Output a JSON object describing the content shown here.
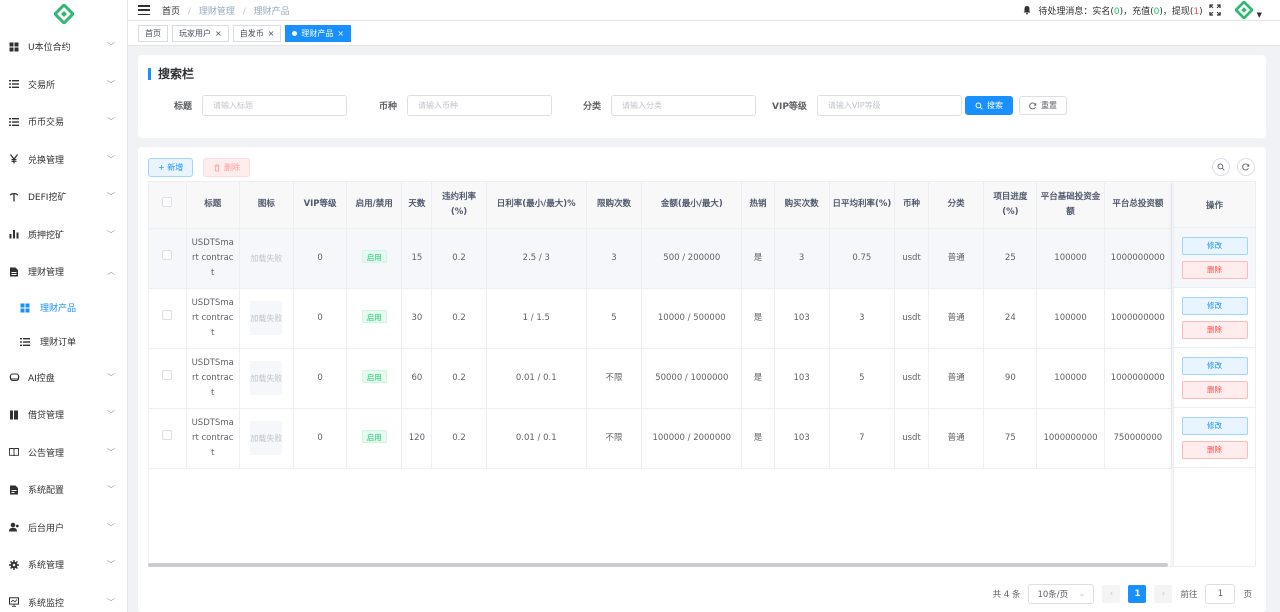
{
  "sidebar": {
    "items": [
      {
        "label": "U本位合约",
        "icon": "grid-icon"
      },
      {
        "label": "交易所",
        "icon": "list-icon"
      },
      {
        "label": "币币交易",
        "icon": "list-icon"
      },
      {
        "label": "兑换管理",
        "icon": "yen-icon"
      },
      {
        "label": "DEFI挖矿",
        "icon": "pickaxe-icon"
      },
      {
        "label": "质押挖矿",
        "icon": "chart-icon"
      },
      {
        "label": "理财管理",
        "icon": "finance-icon"
      }
    ],
    "sub_items": [
      {
        "label": "理财产品",
        "icon": "grid-icon"
      },
      {
        "label": "理财订单",
        "icon": "list-icon"
      }
    ],
    "items_after": [
      {
        "label": "AI控盘",
        "icon": "robot-icon"
      },
      {
        "label": "借贷管理",
        "icon": "book-icon"
      },
      {
        "label": "公告管理",
        "icon": "notice-icon"
      },
      {
        "label": "系统配置",
        "icon": "doc-icon"
      },
      {
        "label": "后台用户",
        "icon": "user-icon"
      },
      {
        "label": "系统管理",
        "icon": "gear-icon"
      },
      {
        "label": "系统监控",
        "icon": "monitor-icon"
      }
    ]
  },
  "header": {
    "breadcrumb": [
      "首页",
      "理财管理",
      "理财产品"
    ],
    "pending_label": "待处理消息：实名(",
    "pending_realname": "0",
    "pending_recharge_label": ")，充值(",
    "pending_recharge": "0",
    "pending_withdraw_label": ")，提现(",
    "pending_withdraw": "1",
    "pending_end": ")"
  },
  "tabs": [
    {
      "label": "首页",
      "closable": false
    },
    {
      "label": "玩家用户",
      "closable": true
    },
    {
      "label": "自发币",
      "closable": true
    },
    {
      "label": "理财产品",
      "closable": true,
      "active": true
    }
  ],
  "search": {
    "title": "搜索栏",
    "fields": [
      {
        "label": "标题",
        "placeholder": "请输入标题"
      },
      {
        "label": "币种",
        "placeholder": "请输入币种"
      },
      {
        "label": "分类",
        "placeholder": "请输入分类"
      },
      {
        "label": "VIP等级",
        "placeholder": "请输入VIP等级"
      }
    ],
    "search_btn": "搜索",
    "reset_btn": "重置"
  },
  "toolbar": {
    "add": "+ 新增",
    "delete": "删除"
  },
  "table": {
    "columns": [
      "标题",
      "图标",
      "VIP等级",
      "启用/禁用",
      "天数",
      "违约利率(%)",
      "日利率(最小/最大)%",
      "限购次数",
      "金额(最小/最大)",
      "热销",
      "购买次数",
      "日平均利率(%)",
      "币种",
      "分类",
      "项目进度(%)",
      "平台基础投资金额",
      "平台总投资额"
    ],
    "ops_header": "操作",
    "rows": [
      {
        "title": "USDTSmart contract",
        "icon": "加载失败",
        "vip": "0",
        "status": "启用",
        "days": "15",
        "penalty": "0.2",
        "daily_rate": "2.5 / 3",
        "limit": "3",
        "amount": "500 / 200000",
        "hot": "是",
        "buys": "3",
        "avg_rate": "0.75",
        "coin": "usdt",
        "category": "普通",
        "progress": "25",
        "base_invest": "100000",
        "total_invest": "1000000000"
      },
      {
        "title": "USDTSmart contract",
        "icon": "加载失败",
        "vip": "0",
        "status": "启用",
        "days": "30",
        "penalty": "0.2",
        "daily_rate": "1 / 1.5",
        "limit": "5",
        "amount": "10000 / 500000",
        "hot": "是",
        "buys": "103",
        "avg_rate": "3",
        "coin": "usdt",
        "category": "普通",
        "progress": "24",
        "base_invest": "100000",
        "total_invest": "1000000000"
      },
      {
        "title": "USDTSmart contract",
        "icon": "加载失败",
        "vip": "0",
        "status": "启用",
        "days": "60",
        "penalty": "0.2",
        "daily_rate": "0.01 / 0.1",
        "limit": "不限",
        "amount": "50000 / 1000000",
        "hot": "是",
        "buys": "103",
        "avg_rate": "5",
        "coin": "usdt",
        "category": "普通",
        "progress": "90",
        "base_invest": "100000",
        "total_invest": "1000000000"
      },
      {
        "title": "USDTSmart contract",
        "icon": "加载失败",
        "vip": "0",
        "status": "启用",
        "days": "120",
        "penalty": "0.2",
        "daily_rate": "0.01 / 0.1",
        "limit": "不限",
        "amount": "100000 / 2000000",
        "hot": "是",
        "buys": "103",
        "avg_rate": "7",
        "coin": "usdt",
        "category": "普通",
        "progress": "75",
        "base_invest": "1000000000",
        "total_invest": "750000000"
      }
    ],
    "edit_label": "修改",
    "delete_label": "删除"
  },
  "pagination": {
    "total": "共 4 条",
    "page_size": "10条/页",
    "current": "1",
    "goto_label": "前往",
    "goto_value": "1",
    "page_unit": "页"
  },
  "colors": {
    "primary": "#1890ff",
    "success": "#13ce66",
    "danger": "#ff4949"
  }
}
